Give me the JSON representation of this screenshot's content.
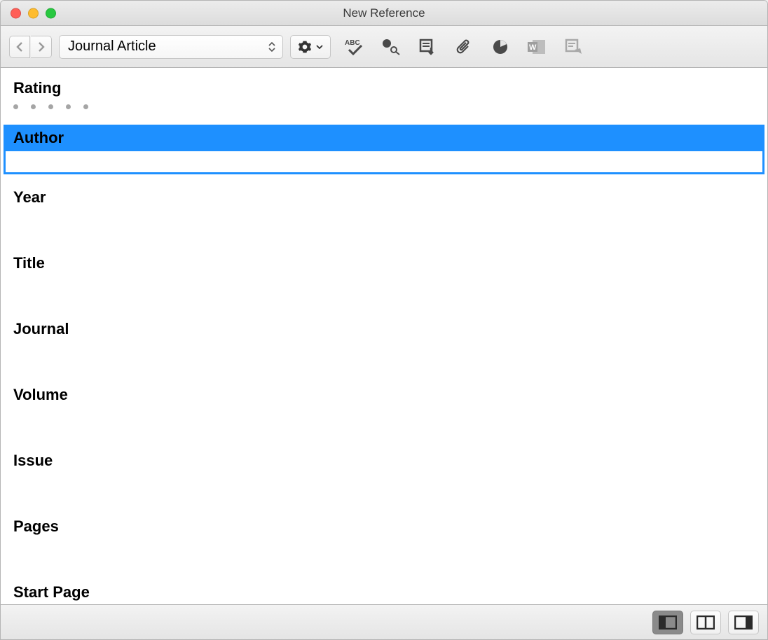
{
  "window": {
    "title": "New Reference"
  },
  "toolbar": {
    "reference_type": "Journal Article"
  },
  "fields": {
    "rating": {
      "label": "Rating"
    },
    "author": {
      "label": "Author",
      "value": ""
    },
    "year": {
      "label": "Year"
    },
    "title": {
      "label": "Title"
    },
    "journal": {
      "label": "Journal"
    },
    "volume": {
      "label": "Volume"
    },
    "issue": {
      "label": "Issue"
    },
    "pages": {
      "label": "Pages"
    },
    "start_page": {
      "label": "Start Page"
    }
  },
  "icons": {
    "gear": "gear-icon",
    "spellcheck": "spellcheck-icon",
    "lookup": "lookup-icon",
    "export": "export-icon",
    "attach": "paperclip-icon",
    "chart": "chart-icon",
    "word": "word-icon",
    "update": "update-icon"
  }
}
